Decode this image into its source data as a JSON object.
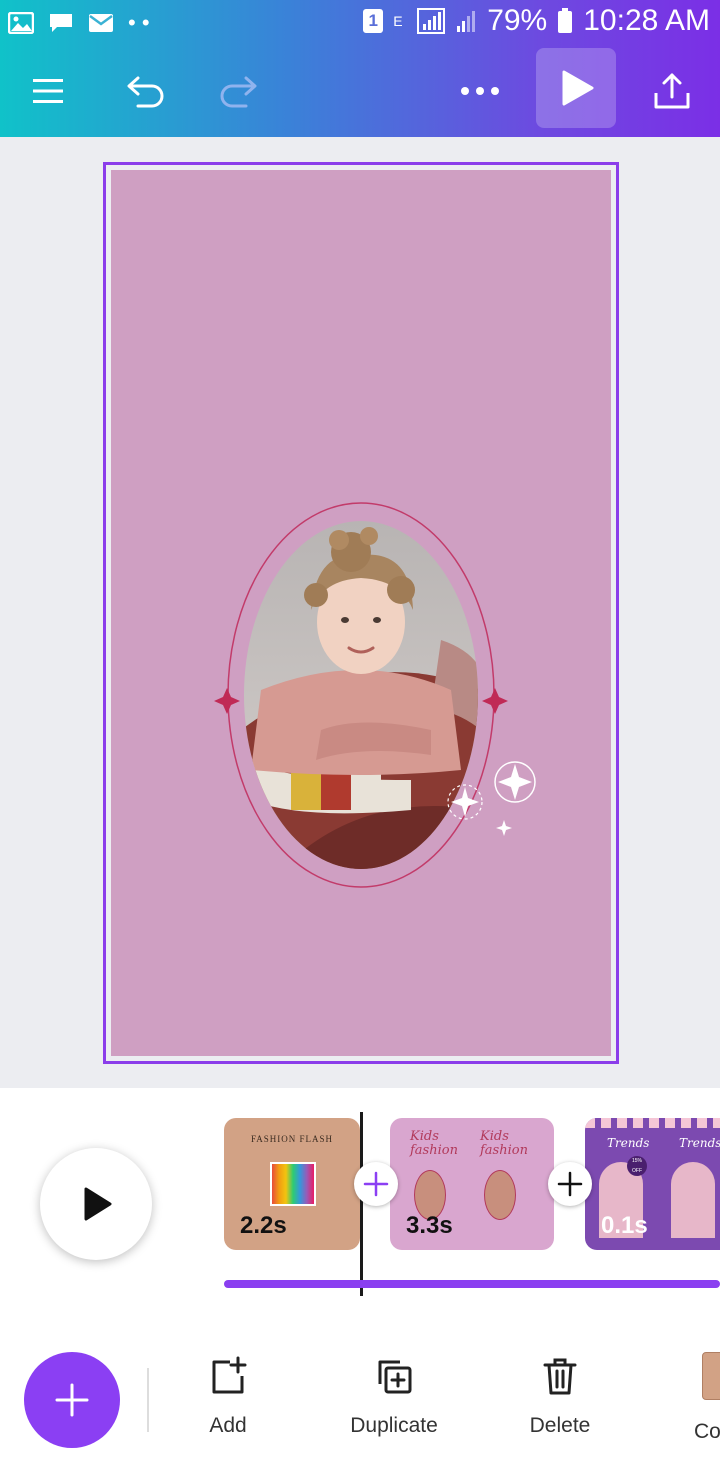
{
  "status_bar": {
    "battery_percent": "79%",
    "time": "10:28 AM",
    "sim_label": "1",
    "network_label": "E"
  },
  "toolbar": {
    "menu_icon": "hamburger-menu-icon",
    "undo_icon": "undo-icon",
    "redo_icon": "redo-icon",
    "more_icon": "more-dots-icon",
    "play_icon": "play-icon",
    "share_icon": "share-export-icon",
    "redo_enabled": false
  },
  "timeline": {
    "clips": [
      {
        "duration": "2.2s",
        "title": "FASHION FLASH",
        "thumb_color": "#d2a285"
      },
      {
        "duration": "3.3s",
        "title": "Kids fashion",
        "title2": "Kids fashion",
        "thumb_color": "#d9a6cf"
      },
      {
        "duration": "0.1s",
        "title": "Trends",
        "title2": "Trends",
        "badge": "15% OFF",
        "thumb_color": "#7c4ab0"
      }
    ]
  },
  "actions": [
    {
      "label": "Add",
      "icon": "add-page-icon"
    },
    {
      "label": "Duplicate",
      "icon": "duplicate-icon"
    },
    {
      "label": "Delete",
      "icon": "trash-icon"
    },
    {
      "label": "Co",
      "icon": "color-swatch-icon"
    }
  ],
  "colors": {
    "accent": "#8b3ff3",
    "canvas_bg": "#cf9fc2",
    "frame_line": "#c23b6a"
  }
}
